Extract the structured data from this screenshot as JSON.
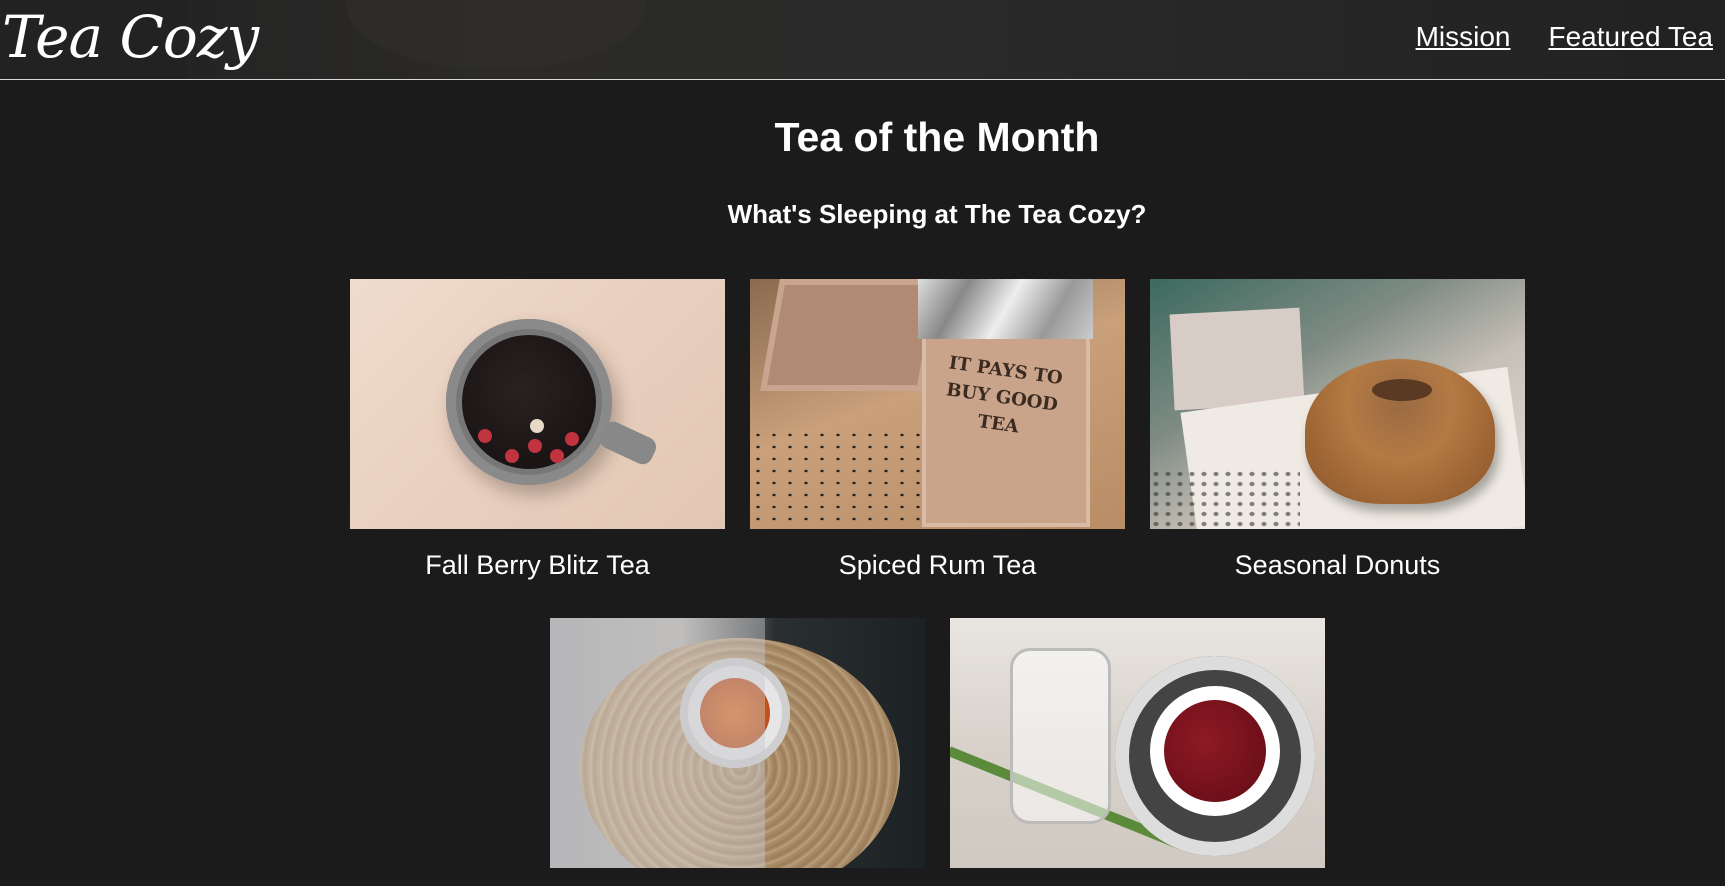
{
  "header": {
    "logo": "Tea Cozy",
    "nav": [
      {
        "label": "Mission"
      },
      {
        "label": "Featured Tea"
      }
    ]
  },
  "main": {
    "title": "Tea of the Month",
    "subtitle": "What's Sleeping at The Tea Cozy?",
    "items": [
      {
        "caption": "Fall Berry Blitz Tea"
      },
      {
        "caption": "Spiced Rum Tea"
      },
      {
        "caption": "Seasonal Donuts"
      },
      {
        "caption": ""
      },
      {
        "caption": ""
      }
    ],
    "box_text": "IT PAYS TO BUY GOOD TEA"
  }
}
